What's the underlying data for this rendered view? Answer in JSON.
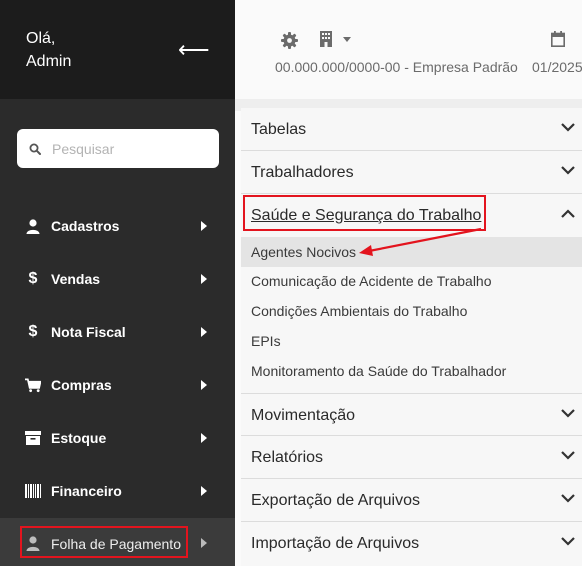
{
  "sidebar": {
    "greeting_line1": "Olá,",
    "greeting_line2": "Admin",
    "back_icon": "arrow-left-icon",
    "search": {
      "placeholder": "Pesquisar",
      "icon": "search-icon"
    },
    "items": [
      {
        "label": "Cadastros",
        "icon": "user-icon"
      },
      {
        "label": "Vendas",
        "icon": "dollar-icon"
      },
      {
        "label": "Nota Fiscal",
        "icon": "dollar-icon"
      },
      {
        "label": "Compras",
        "icon": "cart-icon"
      },
      {
        "label": "Estoque",
        "icon": "archive-icon"
      },
      {
        "label": "Financeiro",
        "icon": "barcode-icon"
      },
      {
        "label": "Folha de Pagamento",
        "icon": "user-icon"
      }
    ]
  },
  "header": {
    "settings_icon": "gear-icon",
    "company_icon": "building-icon",
    "company": "00.000.000/0000-00 - Empresa Padrão",
    "period_icon": "calendar-icon",
    "period": "01/2025"
  },
  "menu": {
    "sections": [
      {
        "label": "Tabelas",
        "expanded": false
      },
      {
        "label": "Trabalhadores",
        "expanded": false
      },
      {
        "label": "Saúde e Segurança do Trabalho",
        "expanded": true
      },
      {
        "label": "Movimentação",
        "expanded": false
      },
      {
        "label": "Relatórios",
        "expanded": false
      },
      {
        "label": "Exportação de Arquivos",
        "expanded": false
      },
      {
        "label": "Importação de Arquivos",
        "expanded": false
      }
    ],
    "open_items": [
      "Agentes Nocivos",
      "Comunicação de Acidente de Trabalho",
      "Condições Ambientais do Trabalho",
      "EPIs",
      "Monitoramento da Saúde do Trabalhador"
    ]
  },
  "colors": {
    "sidebar_bg": "#2b2b2b",
    "sidebar_head_bg": "#1c1c1c",
    "highlight": "#e3141e",
    "selected_bg": "#e4e4e4"
  }
}
